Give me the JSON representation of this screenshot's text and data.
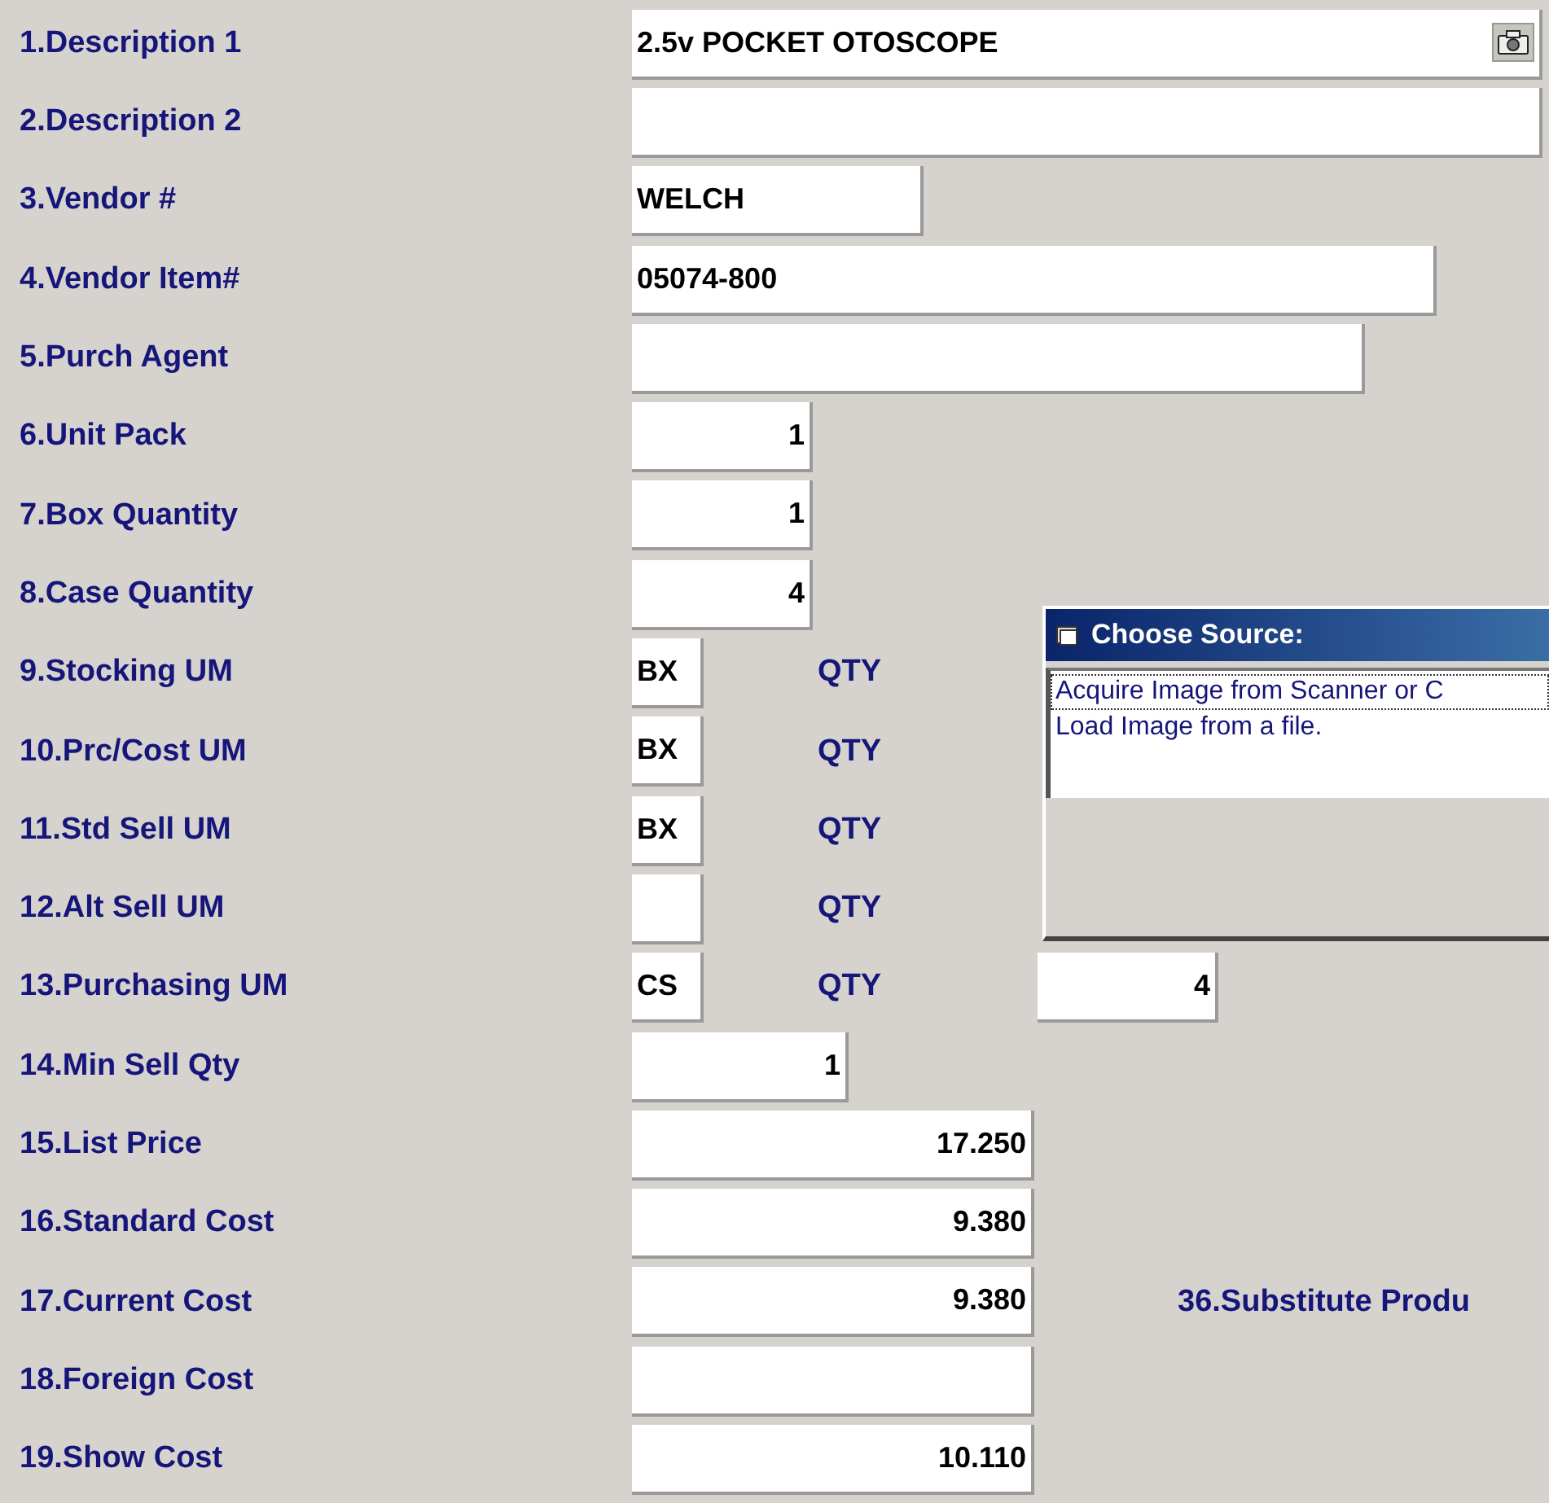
{
  "fields": [
    {
      "label": "1.Description 1",
      "kind": "text",
      "value": "2.5v POCKET OTOSCOPE",
      "camera_button": true
    },
    {
      "label": "2.Description 2",
      "kind": "text"
    },
    {
      "label": "3.Vendor #",
      "kind": "text",
      "value": "WELCH"
    },
    {
      "label": "4.Vendor Item#",
      "kind": "text",
      "value": "05074-800"
    },
    {
      "label": "5.Purch Agent",
      "kind": "text"
    },
    {
      "label": "6.Unit Pack",
      "kind": "number",
      "value": "1"
    },
    {
      "label": "7.Box Quantity",
      "kind": "number",
      "value": "1"
    },
    {
      "label": "8.Case Quantity",
      "kind": "number",
      "value": "4"
    },
    {
      "label": "9.Stocking UM",
      "kind": "um",
      "value": "BX",
      "qty_label": "QTY"
    },
    {
      "label": "10.Prc/Cost UM",
      "kind": "um",
      "value": "BX",
      "qty_label": "QTY"
    },
    {
      "label": "11.Std Sell UM",
      "kind": "um",
      "value": "BX",
      "qty_label": "QTY"
    },
    {
      "label": "12.Alt Sell UM",
      "kind": "um",
      "qty_label": "QTY"
    },
    {
      "label": "13.Purchasing UM",
      "kind": "um",
      "value": "CS",
      "qty_label": "QTY",
      "qty_value": "4"
    },
    {
      "label": "14.Min Sell Qty",
      "kind": "number",
      "value": "1"
    },
    {
      "label": "15.List Price",
      "kind": "number",
      "value": "17.250"
    },
    {
      "label": "16.Standard Cost",
      "kind": "number",
      "value": "9.380"
    },
    {
      "label": "17.Current Cost",
      "kind": "number",
      "value": "9.380",
      "side_label": "36.Substitute Produ"
    },
    {
      "label": "18.Foreign Cost",
      "kind": "number"
    },
    {
      "label": "19.Show Cost",
      "kind": "number",
      "value": "10.110"
    }
  ],
  "dialog": {
    "title": "Choose Source:",
    "items": [
      {
        "label": "Acquire Image from Scanner or C",
        "focused": true
      },
      {
        "label": "Load Image from a file.",
        "focused": false
      }
    ]
  }
}
